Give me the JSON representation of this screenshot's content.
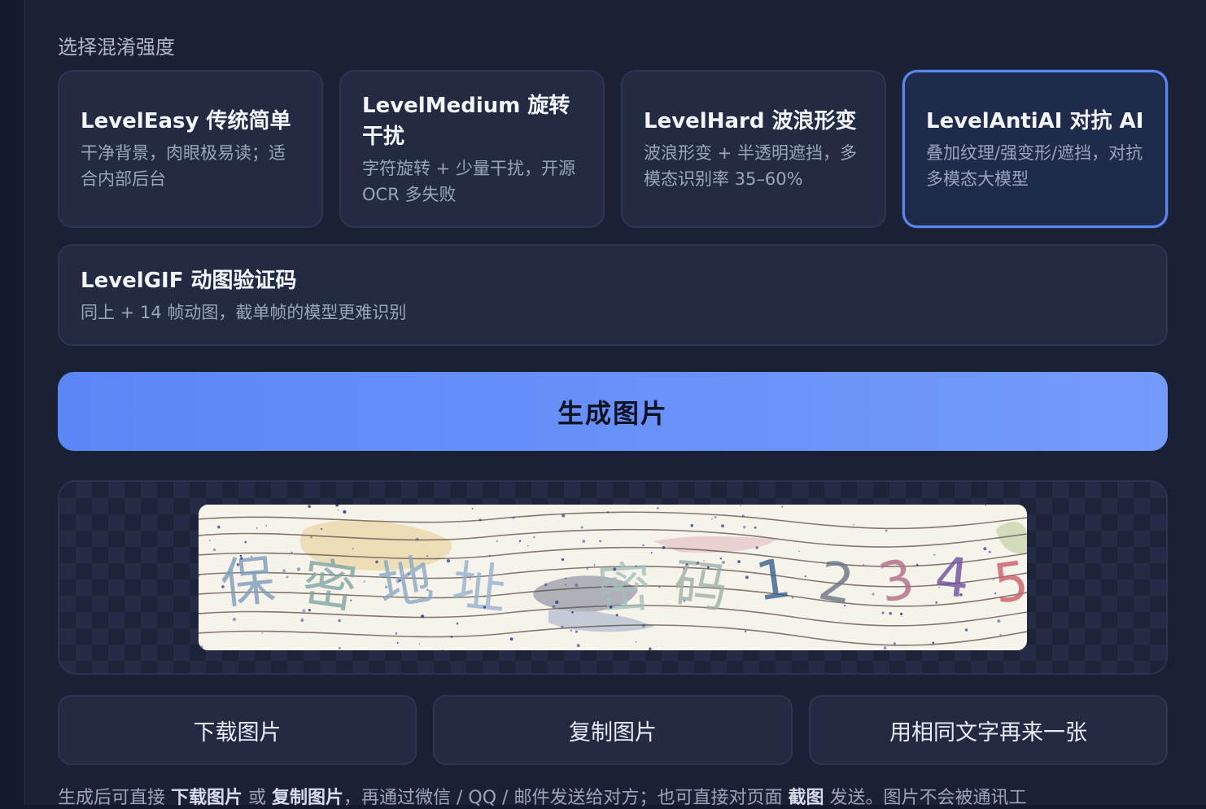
{
  "strength": {
    "label": "选择混淆强度",
    "levels": [
      {
        "title": "LevelEasy 传统简单",
        "desc": "干净背景，肉眼极易读；适合内部后台"
      },
      {
        "title": "LevelMedium 旋转干扰",
        "desc": "字符旋转 + 少量干扰，开源 OCR 多失败"
      },
      {
        "title": "LevelHard 波浪形变",
        "desc": "波浪形变 + 半透明遮挡，多模态识别率 35–60%"
      },
      {
        "title": "LevelAntiAI 对抗 AI",
        "desc": "叠加纹理/强变形/遮挡，对抗多模态大模型"
      },
      {
        "title": "LevelGIF 动图验证码",
        "desc": "同上 + 14 帧动图，截单帧的模型更难识别"
      }
    ],
    "selected_index": 3
  },
  "generate_label": "生成图片",
  "preview": {
    "characters": [
      "保",
      "密",
      "地",
      "址",
      "密",
      "码",
      "1",
      "2",
      "3",
      "4",
      "5"
    ]
  },
  "actions": {
    "download": "下载图片",
    "copy": "复制图片",
    "regenerate": "用相同文字再来一张"
  },
  "footer": {
    "p1": "生成后可直接 ",
    "b1": "下载图片",
    "p2": " 或 ",
    "b2": "复制图片",
    "p3": "，再通过微信 / QQ / 邮件发送给对方；也可直接对页面 ",
    "b3": "截图",
    "p4": " 发送。图片不会被通讯工"
  },
  "colors": {
    "accent": "#5b86f5",
    "panel_bg": "#1a2135",
    "card_bg": "#222b41"
  }
}
